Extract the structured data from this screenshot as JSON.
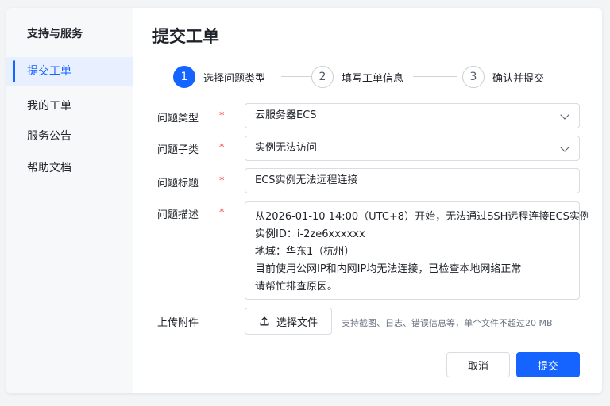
{
  "sidebar": {
    "title": "支持与服务",
    "items": [
      {
        "label": "提交工单",
        "active": true
      },
      {
        "label": "我的工单",
        "active": false
      },
      {
        "label": "服务公告",
        "active": false
      },
      {
        "label": "帮助文档",
        "active": false
      }
    ]
  },
  "page": {
    "title": "提交工单"
  },
  "steps": [
    {
      "number": "1",
      "label": "选择问题类型",
      "active": true
    },
    {
      "number": "2",
      "label": "填写工单信息",
      "active": false
    },
    {
      "number": "3",
      "label": "确认并提交",
      "active": false
    }
  ],
  "form": {
    "required_mark": "*",
    "problem_type": {
      "label": "问题类型",
      "value": "云服务器ECS"
    },
    "problem_subtype": {
      "label": "问题子类",
      "value": "实例无法访问"
    },
    "problem_title": {
      "label": "问题标题",
      "value": "ECS实例无法远程连接"
    },
    "problem_description": {
      "label": "问题描述",
      "lines": [
        "从2026-01-10 14:00（UTC+8）开始，无法通过SSH远程连接ECS实例",
        "实例ID：i-2ze6xxxxxx",
        "地域：华东1（杭州）",
        "目前使用公网IP和内网IP均无法连接，已检查本地网络正常",
        "请帮忙排查原因。"
      ]
    },
    "attachment": {
      "label": "上传附件",
      "button_label": "选择文件",
      "hint": "支持截图、日志、错误信息等，单个文件不超过20 MB"
    }
  },
  "actions": {
    "cancel_label": "取消",
    "submit_label": "提交"
  },
  "colors": {
    "accent": "#1664ff",
    "required": "#f53f3f",
    "active_nav_bg": "#e8f0ff"
  },
  "icons": {
    "select_arrow": "chevron-down-icon",
    "upload": "upload-icon"
  }
}
